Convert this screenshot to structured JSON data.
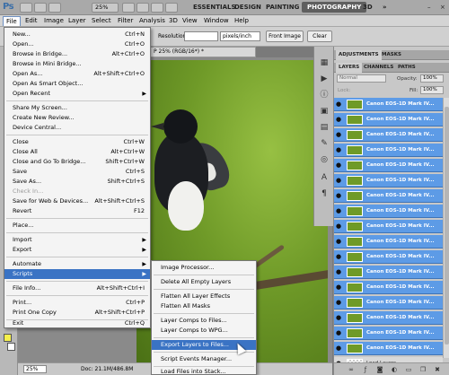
{
  "appbar": {
    "logo": "Ps",
    "zoom": "25%",
    "workspaces": [
      "ESSENTIALS",
      "DESIGN",
      "PAINTING",
      "PHOTOGRAPHY",
      "3D"
    ],
    "expand_icon": "double-chevron-right-icon"
  },
  "menubar": {
    "items": [
      "File",
      "Edit",
      "Image",
      "Layer",
      "Select",
      "Filter",
      "Analysis",
      "3D",
      "View",
      "Window",
      "Help"
    ]
  },
  "options": {
    "resolution_label": "Resolution:",
    "resolution_value": "",
    "resolution_unit": "pixels/inch",
    "front_image": "Front Image",
    "clear": "Clear"
  },
  "document": {
    "tab_title": "P 25% (RGB/16*) *",
    "zoom": "25%",
    "doc_size": "Doc: 21.1M/486.8M"
  },
  "file_menu": {
    "items": [
      {
        "label": "New...",
        "shortcut": "Ctrl+N"
      },
      {
        "label": "Open...",
        "shortcut": "Ctrl+O"
      },
      {
        "label": "Browse in Bridge...",
        "shortcut": "Alt+Ctrl+O"
      },
      {
        "label": "Browse in Mini Bridge...",
        "shortcut": ""
      },
      {
        "label": "Open As...",
        "shortcut": "Alt+Shift+Ctrl+O"
      },
      {
        "label": "Open As Smart Object...",
        "shortcut": ""
      },
      {
        "label": "Open Recent",
        "shortcut": ""
      },
      {
        "label": "Share My Screen...",
        "shortcut": ""
      },
      {
        "label": "Create New Review...",
        "shortcut": ""
      },
      {
        "label": "Device Central...",
        "shortcut": ""
      },
      {
        "label": "Close",
        "shortcut": "Ctrl+W"
      },
      {
        "label": "Close All",
        "shortcut": "Alt+Ctrl+W"
      },
      {
        "label": "Close and Go To Bridge...",
        "shortcut": "Shift+Ctrl+W"
      },
      {
        "label": "Save",
        "shortcut": "Ctrl+S"
      },
      {
        "label": "Save As...",
        "shortcut": "Shift+Ctrl+S"
      },
      {
        "label": "Check In...",
        "shortcut": ""
      },
      {
        "label": "Save for Web & Devices...",
        "shortcut": "Alt+Shift+Ctrl+S"
      },
      {
        "label": "Revert",
        "shortcut": "F12"
      },
      {
        "label": "Place...",
        "shortcut": ""
      },
      {
        "label": "Import",
        "shortcut": ""
      },
      {
        "label": "Export",
        "shortcut": ""
      },
      {
        "label": "Automate",
        "shortcut": ""
      },
      {
        "label": "Scripts",
        "shortcut": ""
      },
      {
        "label": "File Info...",
        "shortcut": "Alt+Shift+Ctrl+I"
      },
      {
        "label": "Print...",
        "shortcut": "Ctrl+P"
      },
      {
        "label": "Print One Copy",
        "shortcut": "Alt+Shift+Ctrl+P"
      },
      {
        "label": "Exit",
        "shortcut": "Ctrl+Q"
      }
    ]
  },
  "scripts_menu": {
    "items": [
      "Image Processor...",
      "Delete All Empty Layers",
      "Flatten All Layer Effects",
      "Flatten All Masks",
      "Layer Comps to Files...",
      "Layer Comps to WPG...",
      "Export Layers to Files...",
      "Script Events Manager...",
      "Load Files into Stack..."
    ]
  },
  "panel": {
    "top_tabs": [
      "ADJUSTMENTS",
      "MASKS"
    ],
    "layer_tabs": [
      "LAYERS",
      "CHANNELS",
      "PATHS"
    ],
    "blend_mode": "Normal",
    "opacity_label": "Opacity:",
    "opacity_value": "100%",
    "lock_label": "Lock:",
    "fill_label": "Fill:",
    "fill_value": "100%",
    "layers": [
      "Canon EOS-1D Mark IV...",
      "Canon EOS-1D Mark IV...",
      "Canon EOS-1D Mark IV...",
      "Canon EOS-1D Mark IV...",
      "Canon EOS-1D Mark IV...",
      "Canon EOS-1D Mark IV...",
      "Canon EOS-1D Mark IV...",
      "Canon EOS-1D Mark IV...",
      "Canon EOS-1D Mark IV...",
      "Canon EOS-1D Mark IV...",
      "Canon EOS-1D Mark IV...",
      "Canon EOS-1D Mark IV...",
      "Canon EOS-1D Mark IV...",
      "Canon EOS-1D Mark IV...",
      "Canon EOS-1D Mark IV...",
      "Canon EOS-1D Mark IV...",
      "Canon EOS-1D Mark IV..."
    ],
    "last_layer": "Load Layers"
  },
  "colors": {
    "menu_highlight": "#3a73c4",
    "layer_selected": "#5d9be6",
    "workspace_active": "#5f5f5f"
  }
}
